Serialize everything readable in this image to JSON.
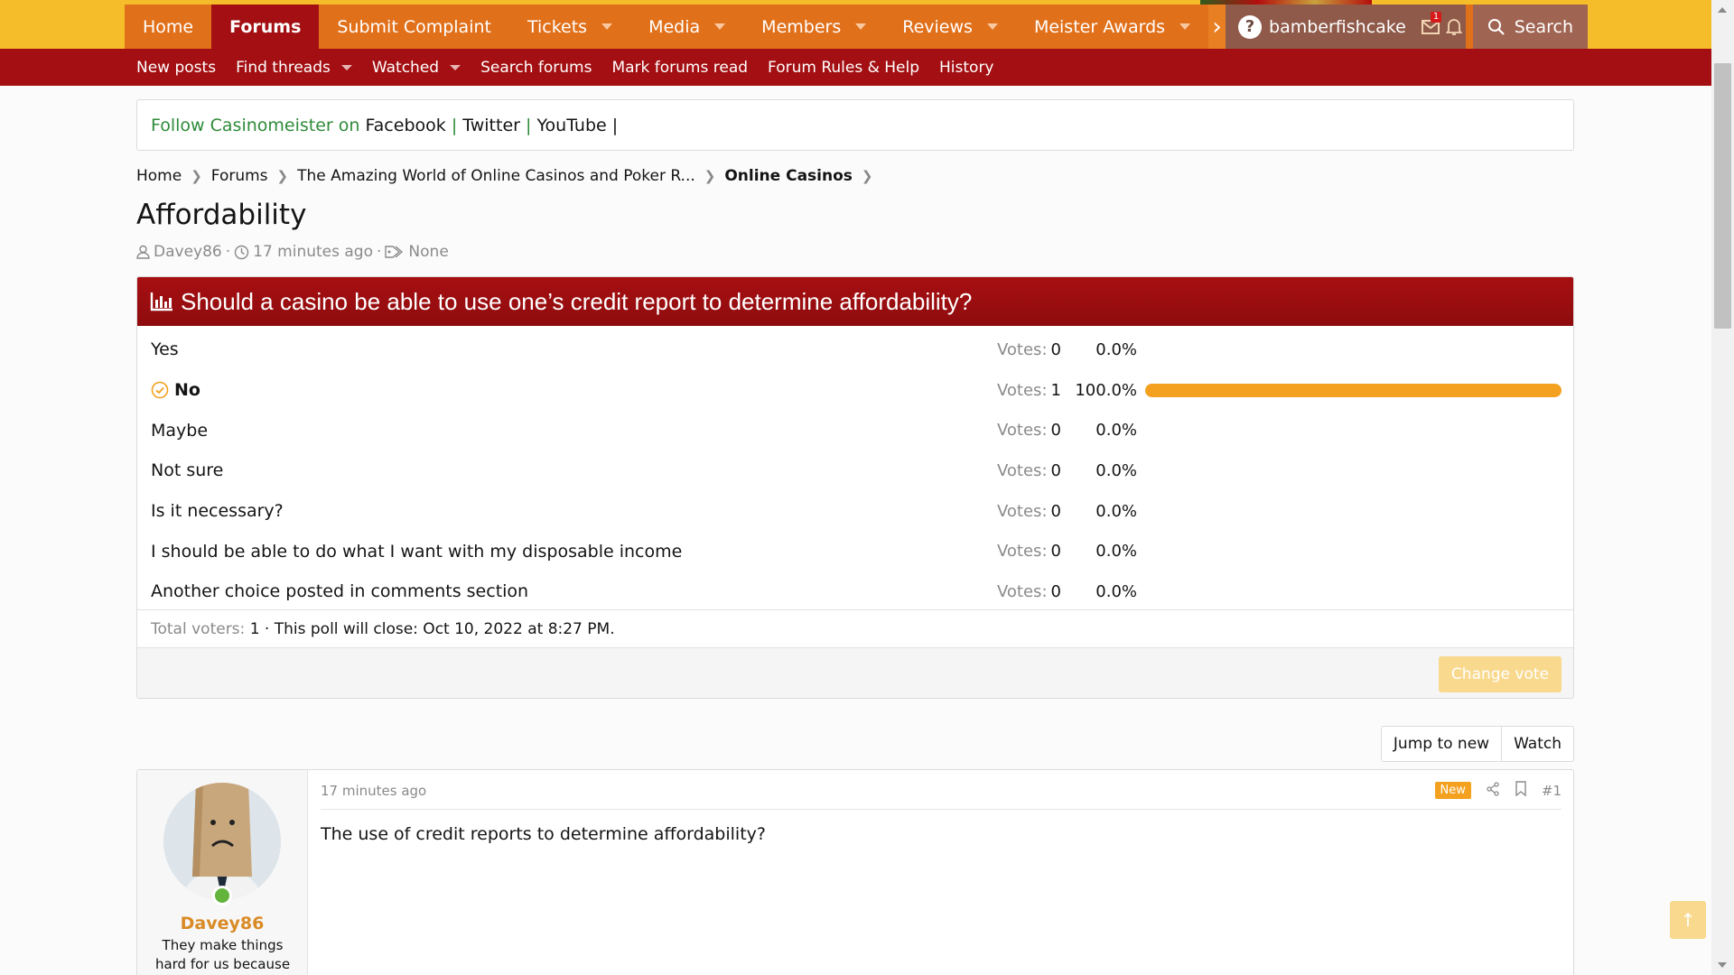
{
  "nav": {
    "tabs": [
      {
        "label": "Home"
      },
      {
        "label": "Forums"
      },
      {
        "label": "Submit Complaint"
      },
      {
        "label": "Tickets"
      },
      {
        "label": "Media"
      },
      {
        "label": "Members"
      },
      {
        "label": "Reviews"
      },
      {
        "label": "Meister Awards"
      }
    ],
    "more_glyph": "›",
    "username": "bamberfishcake",
    "help_glyph": "?",
    "inbox_badge": "1",
    "search_label": "Search"
  },
  "subnav": {
    "items": [
      {
        "label": "New posts"
      },
      {
        "label": "Find threads"
      },
      {
        "label": "Watched"
      },
      {
        "label": "Search forums"
      },
      {
        "label": "Mark forums read"
      },
      {
        "label": "Forum Rules & Help"
      },
      {
        "label": "History"
      }
    ]
  },
  "follow": {
    "prefix": "Follow Casinomeister on",
    "facebook": "Facebook",
    "twitter": "Twitter",
    "youtube": "YouTube",
    "sep": "|"
  },
  "breadcrumb": {
    "items": [
      "Home",
      "Forums",
      "The Amazing World of Online Casinos and Poker R...",
      "Online Casinos"
    ]
  },
  "thread": {
    "title": "Affordability",
    "author": "Davey86",
    "time": "17 minutes ago",
    "tags": "None",
    "sep": "·"
  },
  "poll": {
    "question": "Should a casino be able to use one’s credit report to determine affordability?",
    "votes_label": "Votes:",
    "options": [
      {
        "label": "Yes",
        "votes": "0",
        "pct": "0.0%",
        "fraction": 0
      },
      {
        "label": "No",
        "votes": "1",
        "pct": "100.0%",
        "fraction": 1
      },
      {
        "label": "Maybe",
        "votes": "0",
        "pct": "0.0%",
        "fraction": 0
      },
      {
        "label": "Not sure",
        "votes": "0",
        "pct": "0.0%",
        "fraction": 0
      },
      {
        "label": "Is it necessary?",
        "votes": "0",
        "pct": "0.0%",
        "fraction": 0
      },
      {
        "label": "I should be able to do what I want with my disposable income",
        "votes": "0",
        "pct": "0.0%",
        "fraction": 0
      },
      {
        "label": "Another choice posted in comments section",
        "votes": "0",
        "pct": "0.0%",
        "fraction": 0
      }
    ],
    "total_label": "Total voters:",
    "total_value": "1",
    "close_text": "· This poll will close: Oct 10, 2022 at 8:27 PM.",
    "change_vote": "Change vote",
    "bar_color": "#f3a11e"
  },
  "thread_buttons": {
    "jump": "Jump to new",
    "watch": "Watch"
  },
  "post": {
    "username": "Davey86",
    "user_title": "They make things hard for us because",
    "time": "17 minutes ago",
    "new_badge": "New",
    "number": "#1",
    "body": "The use of credit reports to determine affordability?"
  },
  "colors": {
    "nav_bg": "#e1701a",
    "active_tab": "#a30f12",
    "accent": "#f6bd2a"
  }
}
